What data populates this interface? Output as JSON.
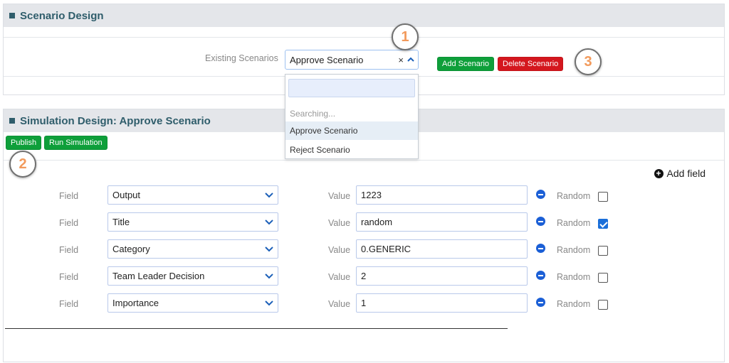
{
  "scenario_panel": {
    "title": "Scenario Design",
    "existing_label": "Existing Scenarios",
    "selected_scenario": "Approve Scenario",
    "clear_symbol": "×",
    "add_button": "Add Scenario",
    "delete_button": "Delete Scenario"
  },
  "dropdown": {
    "search_value": "",
    "status": "Searching...",
    "options": [
      "Approve Scenario",
      "Reject Scenario"
    ]
  },
  "simulation_panel": {
    "title": "Simulation Design: Approve Scenario",
    "publish_button": "Publish",
    "run_button": "Run Simulation",
    "add_field_label": "Add field",
    "field_label": "Field",
    "value_label": "Value",
    "random_label": "Random",
    "rows": [
      {
        "field": "Output",
        "value": "1223",
        "random": false
      },
      {
        "field": "Title",
        "value": "random",
        "random": true
      },
      {
        "field": "Category",
        "value": "0.GENERIC",
        "random": false
      },
      {
        "field": "Team Leader Decision",
        "value": "2",
        "random": false
      },
      {
        "field": "Importance",
        "value": "1",
        "random": false
      }
    ]
  },
  "callouts": [
    "1",
    "2",
    "3"
  ],
  "colors": {
    "header_text": "#2f5d6b",
    "green_button": "#0e9f3a",
    "red_button": "#d4171e",
    "callout_number": "#f29a5c",
    "checkbox_on": "#1b6fd9"
  }
}
